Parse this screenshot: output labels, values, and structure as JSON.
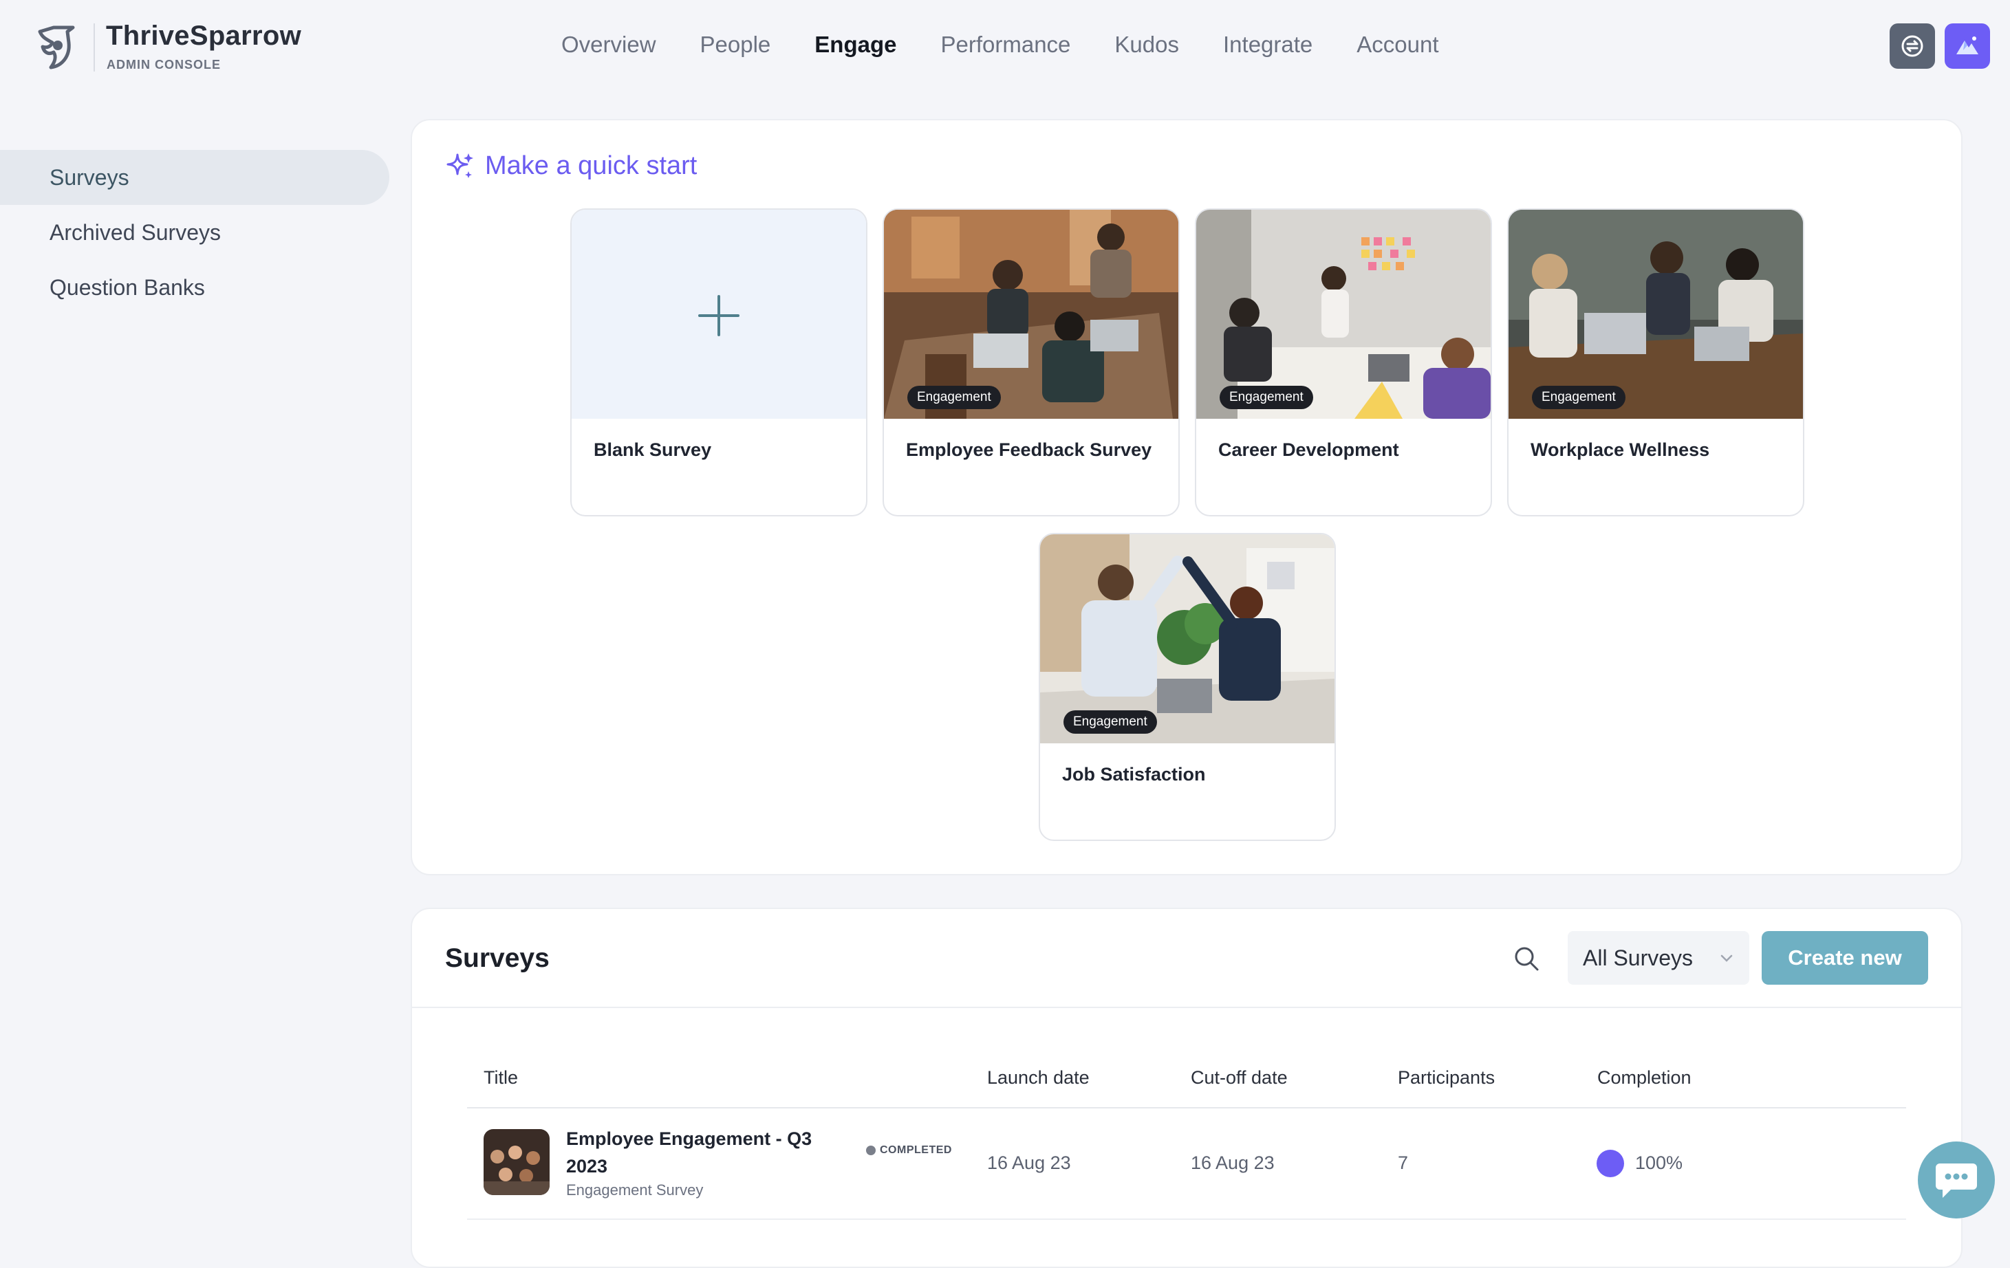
{
  "brand": {
    "name": "ThriveSparrow",
    "subtitle": "ADMIN CONSOLE"
  },
  "nav": [
    "Overview",
    "People",
    "Engage",
    "Performance",
    "Kudos",
    "Integrate",
    "Account"
  ],
  "nav_active": "Engage",
  "header_icons": [
    "sync-icon",
    "mountain-avatar-icon"
  ],
  "sidebar": {
    "items": [
      "Surveys",
      "Archived Surveys",
      "Question Banks"
    ],
    "active": "Surveys"
  },
  "quick_start": {
    "title": "Make a quick start",
    "cards": [
      {
        "label": "Blank Survey",
        "tag": ""
      },
      {
        "label": "Employee Feedback Survey",
        "tag": "Engagement"
      },
      {
        "label": "Career Development",
        "tag": "Engagement"
      },
      {
        "label": "Workplace Wellness",
        "tag": "Engagement"
      },
      {
        "label": "Job Satisfaction",
        "tag": "Engagement"
      }
    ]
  },
  "surveys": {
    "title": "Surveys",
    "filter": "All Surveys",
    "create_label": "Create new",
    "columns": [
      "Title",
      "Launch date",
      "Cut-off date",
      "Participants",
      "Completion"
    ],
    "rows": [
      {
        "title": "Employee Engagement - Q3 2023",
        "subtitle": "Engagement Survey",
        "status": "COMPLETED",
        "launch": "16 Aug 23",
        "cutoff": "16 Aug 23",
        "participants": "7",
        "completion": "100%"
      }
    ]
  },
  "colors": {
    "accent": "#6d5df5",
    "teal": "#6fb0c3",
    "bg": "#f4f5f9"
  }
}
